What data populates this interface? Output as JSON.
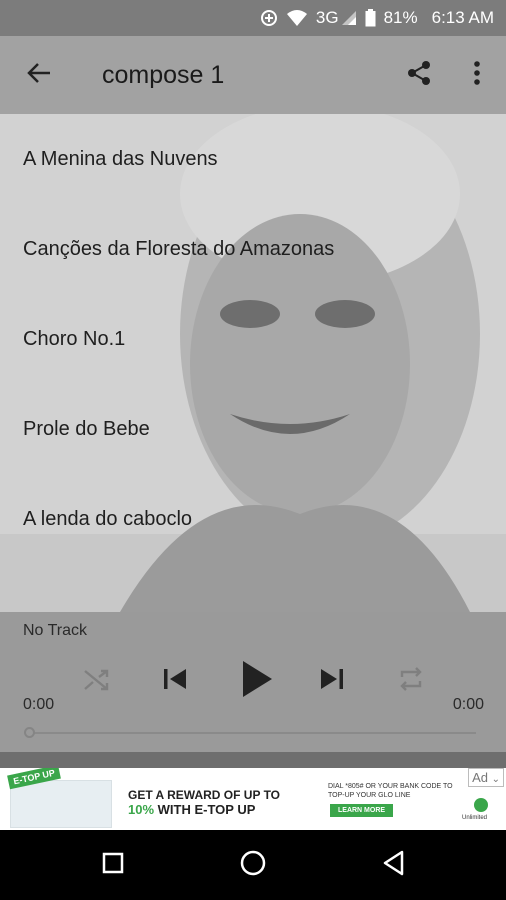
{
  "status_bar": {
    "network": "3G",
    "battery": "81%",
    "time": "6:13 AM"
  },
  "app_bar": {
    "title": "compose 1",
    "icons": [
      "back-arrow-icon",
      "share-icon",
      "more-vert-icon"
    ]
  },
  "tracks": [
    "A Menina das Nuvens",
    "Canções da Floresta do Amazonas",
    "Choro No.1",
    "Prole do Bebe",
    "A lenda do caboclo"
  ],
  "player": {
    "now_playing": "No Track",
    "elapsed": "0:00",
    "duration": "0:00",
    "progress": 0,
    "icons": [
      "shuffle-icon",
      "skip-previous-icon",
      "play-icon",
      "skip-next-icon",
      "repeat-icon"
    ]
  },
  "ad": {
    "tag": "E-TOP UP",
    "headline_1": "GET A REWARD OF UP TO",
    "headline_2_highlight": "10%",
    "headline_2_rest": "WITH E-TOP UP",
    "fine_print": "DIAL *805# OR YOUR BANK CODE TO TOP-UP YOUR GLO LINE",
    "cta": "LEARN MORE",
    "brand": "Unlimited",
    "ad_label": "Ad"
  },
  "colors": {
    "ad_accent": "#3aa64a",
    "app_bar": "#a2a2a2",
    "player": "#9a9a9a"
  }
}
